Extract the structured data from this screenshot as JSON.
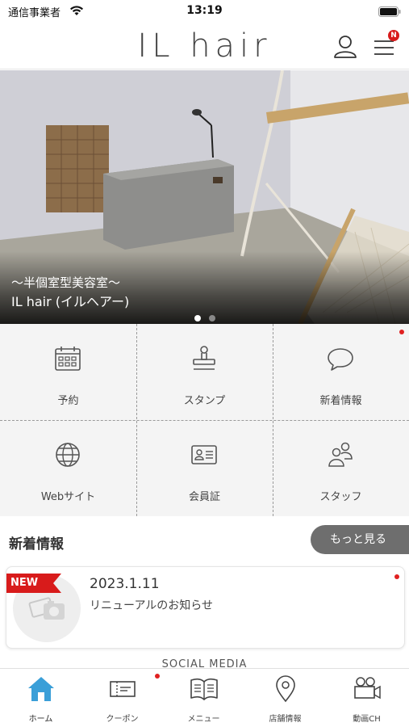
{
  "status_bar": {
    "carrier": "通信事業者",
    "time": "13:19"
  },
  "header": {
    "logo": "IL hair",
    "notification_badge": "N"
  },
  "hero": {
    "subtitle": "〜半個室型美容室〜",
    "title": "IL hair (イルヘアー)",
    "slide_count": 2,
    "active_slide": 1
  },
  "menu": [
    {
      "label": "予約",
      "icon": "calendar-icon"
    },
    {
      "label": "スタンプ",
      "icon": "stamp-icon"
    },
    {
      "label": "新着情報",
      "icon": "speech-bubble-icon",
      "has_notification": true
    },
    {
      "label": "Webサイト",
      "icon": "globe-icon"
    },
    {
      "label": "会員証",
      "icon": "member-card-icon"
    },
    {
      "label": "スタッフ",
      "icon": "staff-icon"
    }
  ],
  "news": {
    "title": "新着情報",
    "more_label": "もっと見る",
    "items": [
      {
        "tag": "NEW",
        "date": "2023.1.11",
        "text": "リニューアルのお知らせ",
        "unread": true
      }
    ]
  },
  "social_title": "SOCIAL MEDIA",
  "tabs": [
    {
      "label": "ホーム",
      "icon": "home-icon",
      "active": true
    },
    {
      "label": "クーポン",
      "icon": "coupon-icon",
      "has_notification": true
    },
    {
      "label": "メニュー",
      "icon": "book-icon"
    },
    {
      "label": "店舗情報",
      "icon": "map-pin-icon"
    },
    {
      "label": "動画CH",
      "icon": "video-camera-icon"
    }
  ],
  "colors": {
    "accent": "#d81b1b",
    "home_tab": "#3a9fd8",
    "more_button": "#6e6e6e"
  }
}
